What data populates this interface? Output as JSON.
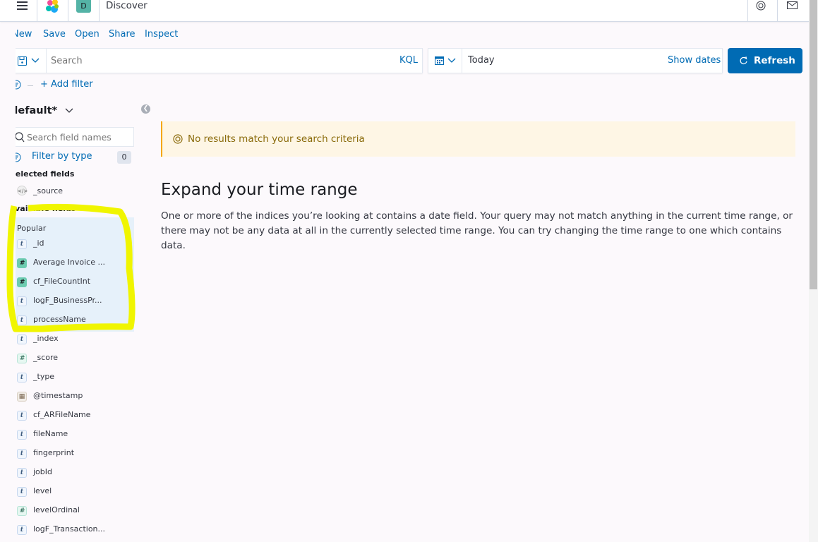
{
  "header": {
    "title": "Discover",
    "space_initial": "D",
    "space_color": "#54b3a6"
  },
  "nav": {
    "new": "New",
    "save": "Save",
    "open": "Open",
    "share": "Share",
    "inspect": "Inspect"
  },
  "query": {
    "placeholder": "Search",
    "language": "KQL"
  },
  "datepicker": {
    "value": "Today",
    "show_dates": "Show dates"
  },
  "refresh": {
    "label": "Refresh",
    "color": "#006bb4"
  },
  "filters": {
    "add_filter": "+ Add filter"
  },
  "sidebar": {
    "index_pattern": "default*",
    "search_placeholder": "Search field names",
    "filter_by_type": "Filter by type",
    "filter_count": "0",
    "selected_title": "Selected fields",
    "selected": [
      {
        "name": "_source",
        "type": "source"
      }
    ],
    "available_title": "Available fields",
    "popular_title": "Popular",
    "popular": [
      {
        "name": "_id",
        "type": "t"
      },
      {
        "name": "Average Invoice ...",
        "type": "#"
      },
      {
        "name": "cf_FileCountInt",
        "type": "#"
      },
      {
        "name": "logF_BusinessPr...",
        "type": "t"
      },
      {
        "name": "processName",
        "type": "t"
      }
    ],
    "fields": [
      {
        "name": "_index",
        "type": "t"
      },
      {
        "name": "_score",
        "type": "#"
      },
      {
        "name": "_type",
        "type": "t"
      },
      {
        "name": "@timestamp",
        "type": "date"
      },
      {
        "name": "cf_ARFileName",
        "type": "t"
      },
      {
        "name": "fileName",
        "type": "t"
      },
      {
        "name": "fingerprint",
        "type": "t"
      },
      {
        "name": "jobId",
        "type": "t"
      },
      {
        "name": "level",
        "type": "t"
      },
      {
        "name": "levelOrdinal",
        "type": "#"
      },
      {
        "name": "logF_Transaction...",
        "type": "t"
      }
    ]
  },
  "main": {
    "callout": "No results match your search criteria",
    "heading": "Expand your time range",
    "body": "One or more of the indices you’re looking at contains a date field. Your query may not match anything in the current time range, or there may not be any data at all in the currently selected time range. You can try changing the time range to one which contains data."
  },
  "annotation": {
    "highlight_color": "#f0f500"
  }
}
